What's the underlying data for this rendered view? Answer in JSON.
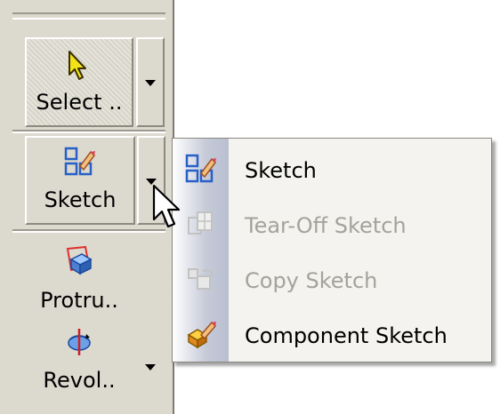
{
  "toolbar": {
    "select_label": "Select ..",
    "sketch_label": "Sketch",
    "protrude_label": "Protru..",
    "revolve_label": "Revol.."
  },
  "menu": {
    "items": [
      {
        "label": "Sketch",
        "enabled": true,
        "icon": "sketch-icon"
      },
      {
        "label": "Tear-Off Sketch",
        "enabled": false,
        "icon": "tear-off-sketch-icon"
      },
      {
        "label": "Copy Sketch",
        "enabled": false,
        "icon": "copy-sketch-icon"
      },
      {
        "label": "Component Sketch",
        "enabled": true,
        "icon": "component-sketch-icon"
      }
    ]
  },
  "colors": {
    "toolbar_bg": "#dcd9cf",
    "menu_bg": "#f4f3ef",
    "disabled_text": "#a3a29c"
  }
}
